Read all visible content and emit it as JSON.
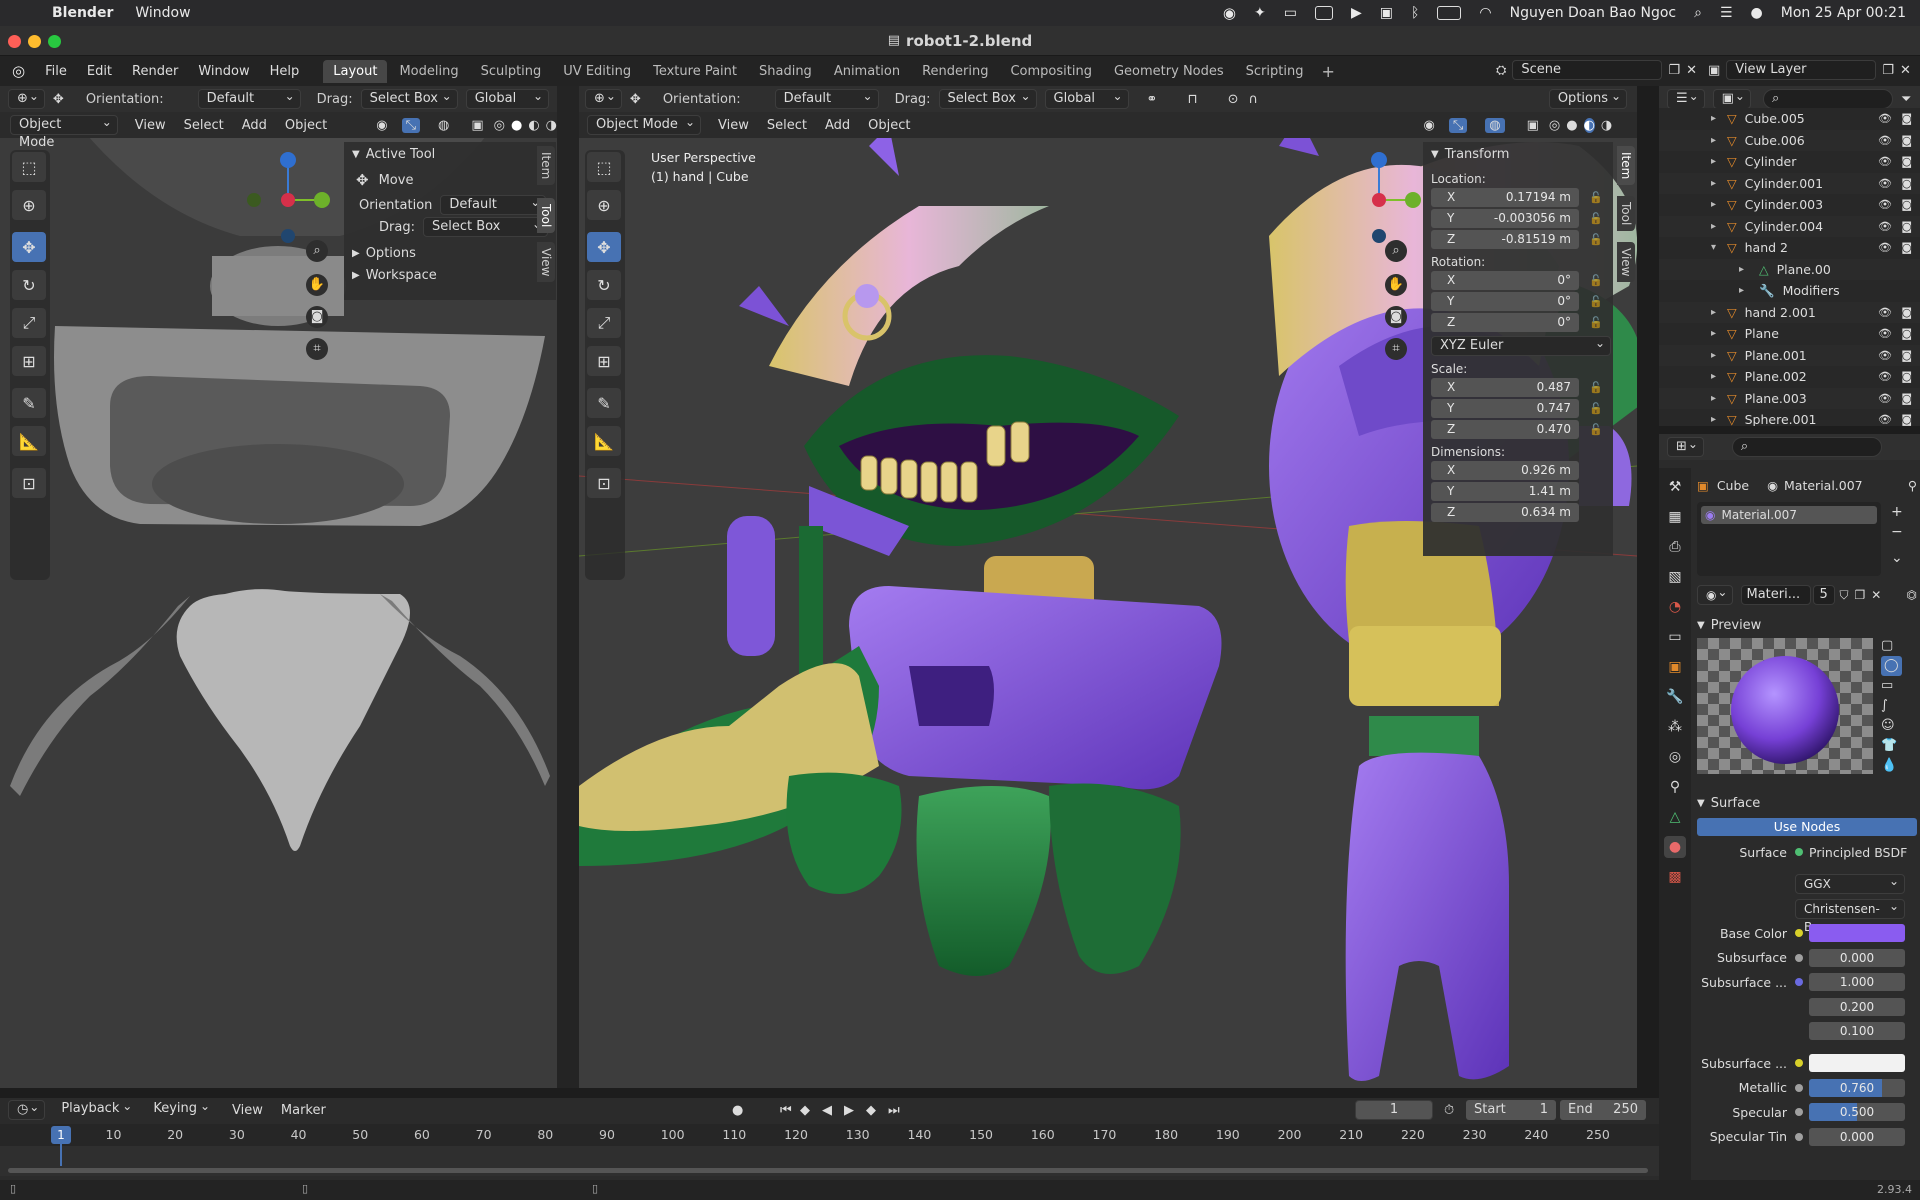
{
  "mac": {
    "app": "Blender",
    "menus": [
      "Window"
    ],
    "user": "Nguyen Doan Bao Ngoc",
    "datetime": "Mon 25 Apr  00:21"
  },
  "window": {
    "title": "robot1-2.blend"
  },
  "top": {
    "menus": [
      "File",
      "Edit",
      "Render",
      "Window",
      "Help"
    ],
    "workspaces": [
      "Layout",
      "Modeling",
      "Sculpting",
      "UV Editing",
      "Texture Paint",
      "Shading",
      "Animation",
      "Rendering",
      "Compositing",
      "Geometry Nodes",
      "Scripting"
    ],
    "active_workspace": "Layout",
    "scene": "Scene",
    "view_layer": "View Layer"
  },
  "left_view": {
    "orientation_label": "Orientation:",
    "orientation": "Default",
    "drag_label": "Drag:",
    "drag": "Select Box",
    "transform": "Global",
    "mode": "Object Mode",
    "menus": [
      "View",
      "Select",
      "Add",
      "Object"
    ],
    "active_tool": {
      "title": "Active Tool",
      "tool": "Move",
      "orientation_label": "Orientation",
      "orientation": "Default",
      "drag_label": "Drag:",
      "drag": "Select Box",
      "options": "Options",
      "workspace": "Workspace"
    },
    "tabs": [
      "Item",
      "Tool",
      "View"
    ]
  },
  "main_view": {
    "orientation_label": "Orientation:",
    "orientation": "Default",
    "drag_label": "Drag:",
    "drag": "Select Box",
    "transform": "Global",
    "options": "Options",
    "mode": "Object Mode",
    "menus": [
      "View",
      "Select",
      "Add",
      "Object"
    ],
    "perspective": "User Perspective",
    "object": "(1) hand | Cube",
    "tabs": [
      "Item",
      "Tool",
      "View"
    ],
    "transform_panel": {
      "title": "Transform",
      "location_label": "Location:",
      "location": [
        {
          "axis": "X",
          "value": "0.17194 m"
        },
        {
          "axis": "Y",
          "value": "-0.003056 m"
        },
        {
          "axis": "Z",
          "value": "-0.81519 m"
        }
      ],
      "rotation_label": "Rotation:",
      "rotation": [
        {
          "axis": "X",
          "value": "0°"
        },
        {
          "axis": "Y",
          "value": "0°"
        },
        {
          "axis": "Z",
          "value": "0°"
        }
      ],
      "rotation_mode": "XYZ Euler",
      "scale_label": "Scale:",
      "scale": [
        {
          "axis": "X",
          "value": "0.487"
        },
        {
          "axis": "Y",
          "value": "0.747"
        },
        {
          "axis": "Z",
          "value": "0.470"
        }
      ],
      "dimensions_label": "Dimensions:",
      "dimensions": [
        {
          "axis": "X",
          "value": "0.926 m"
        },
        {
          "axis": "Y",
          "value": "1.41 m"
        },
        {
          "axis": "Z",
          "value": "0.634 m"
        }
      ]
    }
  },
  "outliner": {
    "items": [
      {
        "name": "Cube.005",
        "indent": 0
      },
      {
        "name": "Cube.006",
        "indent": 0
      },
      {
        "name": "Cylinder",
        "indent": 0
      },
      {
        "name": "Cylinder.001",
        "indent": 0
      },
      {
        "name": "Cylinder.003",
        "indent": 0
      },
      {
        "name": "Cylinder.004",
        "indent": 0
      },
      {
        "name": "hand 2",
        "indent": 0
      },
      {
        "name": "Plane.00",
        "indent": 1
      },
      {
        "name": "Modifiers",
        "indent": 1
      },
      {
        "name": "hand 2.001",
        "indent": 0
      },
      {
        "name": "Plane",
        "indent": 0
      },
      {
        "name": "Plane.001",
        "indent": 0
      },
      {
        "name": "Plane.002",
        "indent": 0
      },
      {
        "name": "Plane.003",
        "indent": 0
      },
      {
        "name": "Sphere.001",
        "indent": 0
      }
    ]
  },
  "properties": {
    "object": "Cube",
    "material": "Material.007",
    "slot": "Material.007",
    "material_field": "Materi...",
    "users": "5",
    "preview": "Preview",
    "surface": "Surface",
    "use_nodes": "Use Nodes",
    "surface_label": "Surface",
    "shader": "Principled BSDF",
    "distribution": "GGX",
    "subsurface_method": "Christensen-Bu...",
    "base_color_label": "Base Color",
    "base_color": "#8a5cf0",
    "subsurface_label": "Subsurface",
    "subsurface": "0.000",
    "subsurface_radius_label": "Subsurface ...",
    "subsurface_radius": [
      "1.000",
      "0.200",
      "0.100"
    ],
    "subsurface_color_label": "Subsurface ...",
    "metallic_label": "Metallic",
    "metallic": "0.760",
    "metallic_fill": 0.76,
    "specular_label": "Specular",
    "specular": "0.500",
    "specular_fill": 0.5,
    "specular_tint_label": "Specular Tin",
    "specular_tint": "0.000"
  },
  "timeline": {
    "menus": [
      "Playback",
      "Keying",
      "View",
      "Marker"
    ],
    "current_frame": "1",
    "start_label": "Start",
    "start": "1",
    "end_label": "End",
    "end": "250",
    "ticks": [
      "1",
      "10",
      "20",
      "30",
      "40",
      "50",
      "60",
      "70",
      "80",
      "90",
      "100",
      "110",
      "120",
      "130",
      "140",
      "150",
      "160",
      "170",
      "180",
      "190",
      "200",
      "210",
      "220",
      "230",
      "240",
      "250"
    ]
  },
  "status": {
    "version": "2.93.4"
  }
}
